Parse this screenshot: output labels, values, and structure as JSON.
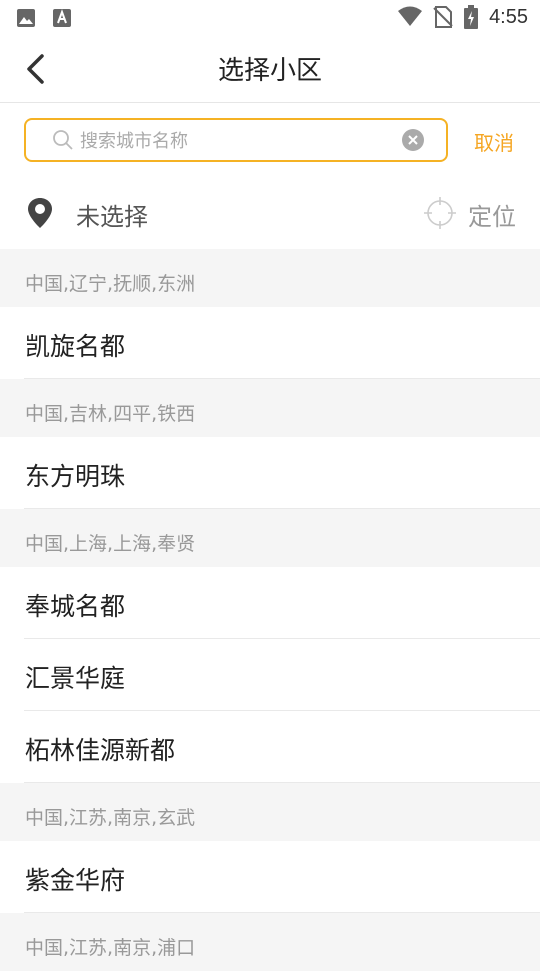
{
  "status_bar": {
    "time": "4:55"
  },
  "header": {
    "title": "选择小区"
  },
  "search": {
    "placeholder": "搜索城市名称",
    "value": "",
    "cancel_label": "取消"
  },
  "location": {
    "current": "未选择",
    "locate_label": "定位"
  },
  "groups": [
    {
      "region": "中国,辽宁,抚顺,东洲",
      "items": [
        "凯旋名都"
      ]
    },
    {
      "region": "中国,吉林,四平,铁西",
      "items": [
        "东方明珠"
      ]
    },
    {
      "region": "中国,上海,上海,奉贤",
      "items": [
        "奉城名都",
        "汇景华庭",
        "柘林佳源新都"
      ]
    },
    {
      "region": "中国,江苏,南京,玄武",
      "items": [
        "紫金华府"
      ]
    },
    {
      "region": "中国,江苏,南京,浦口",
      "items": []
    }
  ],
  "colors": {
    "accent": "#f5a623",
    "header_bg": "#f5f5f5"
  }
}
